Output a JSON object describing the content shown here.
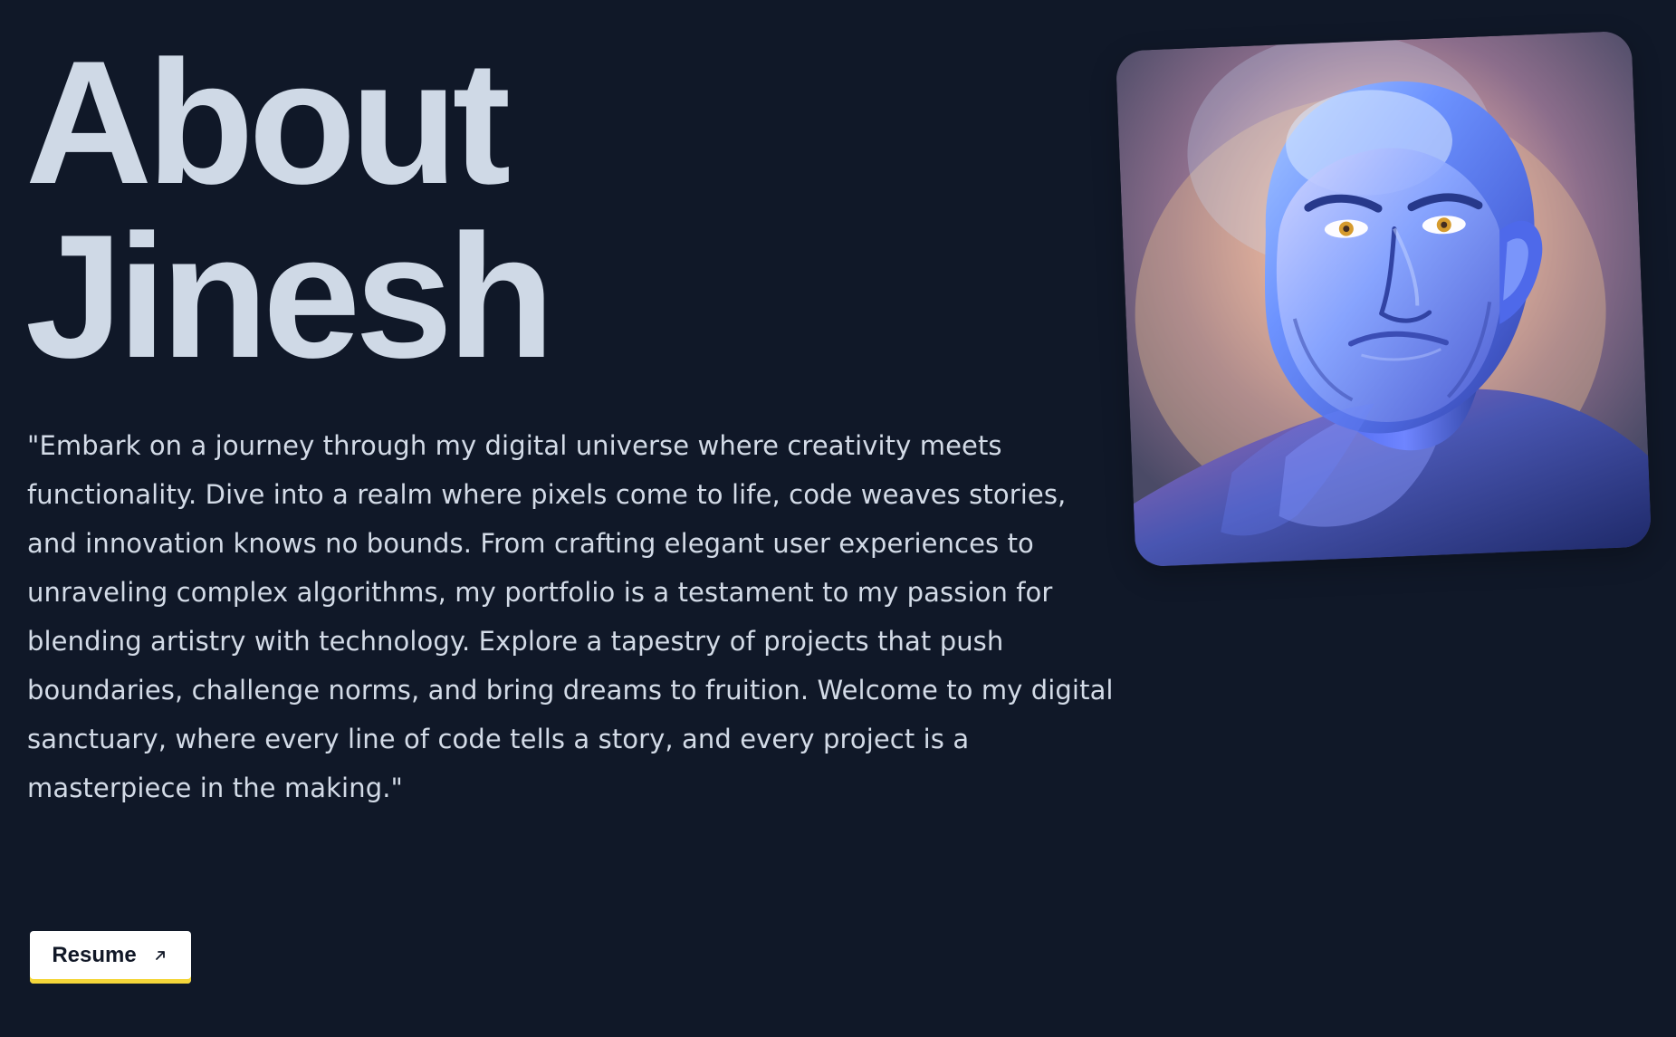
{
  "hero": {
    "title_line1": "About",
    "title_line2": "Jinesh"
  },
  "bio": {
    "text": "\"Embark on a journey through my digital universe where creativity meets functionality. Dive into a realm where pixels come to life, code weaves stories, and innovation knows no bounds. From crafting elegant user experiences to unraveling complex algorithms, my portfolio is a testament to my passion for blending artistry with technology. Explore a tapestry of projects that push boundaries, challenge norms, and bring dreams to fruition. Welcome to my digital sanctuary, where every line of code tells a story, and every project is a masterpiece in the making.\""
  },
  "resume": {
    "label": "Resume",
    "icon": "arrow-up-right-icon"
  },
  "portrait": {
    "icon": "avatar-portrait"
  },
  "colors": {
    "background": "#101828",
    "text": "#d0d8e5",
    "button_bg": "#ffffff",
    "button_accent": "#f4d63a"
  }
}
